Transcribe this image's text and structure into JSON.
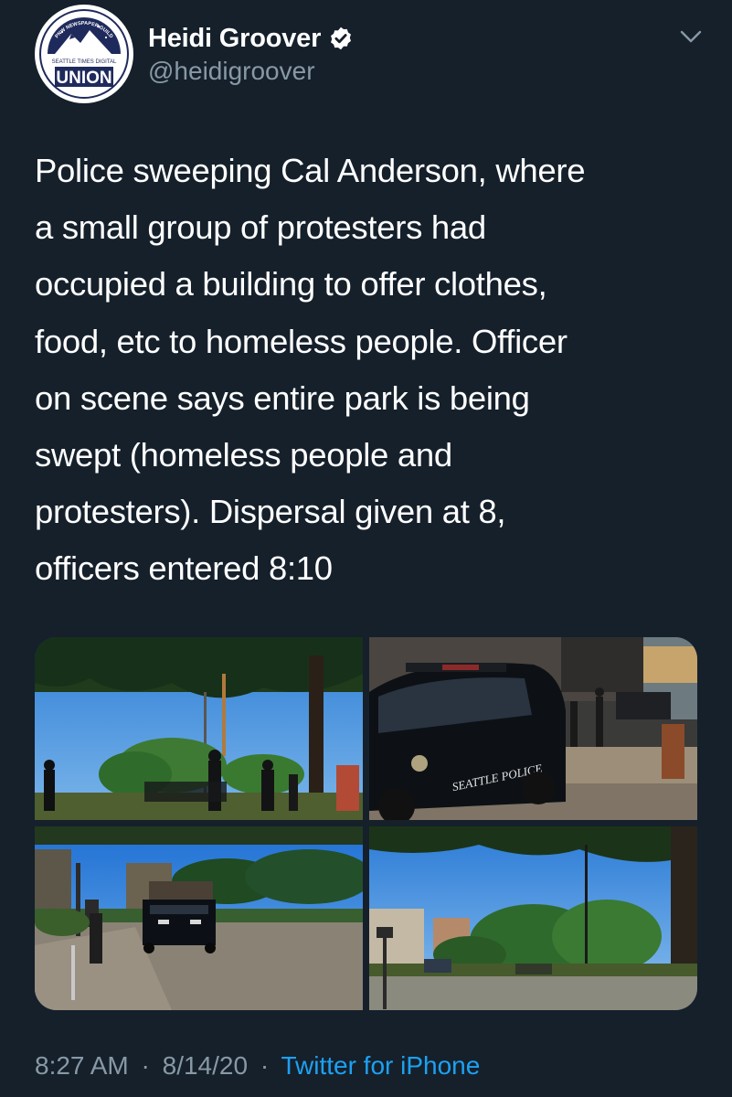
{
  "author": {
    "display_name": "Heidi Groover",
    "handle": "@heidigroover",
    "avatar": {
      "arc_text": "PNW NEWSPAPER GUILD",
      "top_text": "SEATTLE TIMES DIGITAL",
      "main_text": "UNION",
      "colors": {
        "navy": "#1f2a5c",
        "ring": "#1f2a5c",
        "background": "#ffffff"
      }
    },
    "verified_icon": "verified-badge-icon"
  },
  "menu_icon": "chevron-down-icon",
  "tweet": {
    "lines": [
      "Police sweeping Cal Anderson, where",
      "a small group of protesters had",
      "occupied a building to offer clothes,",
      "food, etc to homeless people. Officer",
      "on scene says entire park is being",
      "swept (homeless people and",
      "protesters). Dispersal given at 8,",
      "officers entered 8:10"
    ]
  },
  "media": {
    "photos": [
      {
        "description": "park-trees-people"
      },
      {
        "description": "police-suv",
        "vehicle_text": "SEATTLE POLICE"
      },
      {
        "description": "police-suv-path"
      },
      {
        "description": "park-lawn-trees"
      }
    ]
  },
  "meta": {
    "time": "8:27 AM",
    "separator": "·",
    "date": "8/14/20",
    "source": "Twitter for iPhone"
  },
  "colors": {
    "background": "#15202b",
    "text": "#ffffff",
    "secondary_text": "#8899a6",
    "link": "#1da1f2"
  }
}
